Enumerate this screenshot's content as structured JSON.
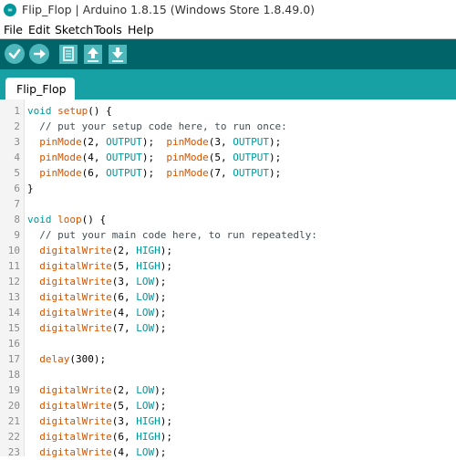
{
  "window": {
    "title": "Flip_Flop | Arduino 1.8.15 (Windows Store 1.8.49.0)",
    "logo_icon": "arduino-logo-icon"
  },
  "menu": [
    "File",
    "Edit",
    "Sketch",
    "Tools",
    "Help"
  ],
  "toolbar": {
    "buttons": [
      {
        "name": "verify",
        "icon": "checkmark-icon"
      },
      {
        "name": "upload",
        "icon": "right-arrow-icon"
      },
      {
        "name": "new",
        "icon": "document-icon"
      },
      {
        "name": "open",
        "icon": "up-arrow-icon"
      },
      {
        "name": "save",
        "icon": "down-arrow-icon"
      }
    ],
    "colors": {
      "bar": "#006468",
      "button": "#4db7bb",
      "tab_bar": "#17a1a5"
    }
  },
  "tabs": [
    {
      "label": "Flip_Flop",
      "active": true
    }
  ],
  "editor": {
    "syntax_colors": {
      "type": "#00979c",
      "function": "#d35400",
      "constant": "#00979c",
      "comment": "#434f54"
    },
    "lines": [
      {
        "n": "1",
        "tokens": [
          [
            "t",
            "void"
          ],
          [
            "p",
            " "
          ],
          [
            "f",
            "setup"
          ],
          [
            "p",
            "() {"
          ]
        ]
      },
      {
        "n": "2",
        "tokens": [
          [
            "c",
            "  // put your setup code here, to run once:"
          ]
        ]
      },
      {
        "n": "3",
        "tokens": [
          [
            "p",
            "  "
          ],
          [
            "f",
            "pinMode"
          ],
          [
            "p",
            "(2, "
          ],
          [
            "k",
            "OUTPUT"
          ],
          [
            "p",
            ");  "
          ],
          [
            "f",
            "pinMode"
          ],
          [
            "p",
            "(3, "
          ],
          [
            "k",
            "OUTPUT"
          ],
          [
            "p",
            ");"
          ]
        ]
      },
      {
        "n": "4",
        "tokens": [
          [
            "p",
            "  "
          ],
          [
            "f",
            "pinMode"
          ],
          [
            "p",
            "(4, "
          ],
          [
            "k",
            "OUTPUT"
          ],
          [
            "p",
            ");  "
          ],
          [
            "f",
            "pinMode"
          ],
          [
            "p",
            "(5, "
          ],
          [
            "k",
            "OUTPUT"
          ],
          [
            "p",
            ");"
          ]
        ]
      },
      {
        "n": "5",
        "tokens": [
          [
            "p",
            "  "
          ],
          [
            "f",
            "pinMode"
          ],
          [
            "p",
            "(6, "
          ],
          [
            "k",
            "OUTPUT"
          ],
          [
            "p",
            ");  "
          ],
          [
            "f",
            "pinMode"
          ],
          [
            "p",
            "(7, "
          ],
          [
            "k",
            "OUTPUT"
          ],
          [
            "p",
            ");"
          ]
        ]
      },
      {
        "n": "6",
        "tokens": [
          [
            "p",
            "}"
          ]
        ]
      },
      {
        "n": "7",
        "tokens": []
      },
      {
        "n": "8",
        "tokens": [
          [
            "t",
            "void"
          ],
          [
            "p",
            " "
          ],
          [
            "f",
            "loop"
          ],
          [
            "p",
            "() {"
          ]
        ]
      },
      {
        "n": "9",
        "tokens": [
          [
            "c",
            "  // put your main code here, to run repeatedly:"
          ]
        ]
      },
      {
        "n": "10",
        "tokens": [
          [
            "p",
            "  "
          ],
          [
            "f",
            "digitalWrite"
          ],
          [
            "p",
            "(2, "
          ],
          [
            "k",
            "HIGH"
          ],
          [
            "p",
            ");"
          ]
        ]
      },
      {
        "n": "11",
        "tokens": [
          [
            "p",
            "  "
          ],
          [
            "f",
            "digitalWrite"
          ],
          [
            "p",
            "(5, "
          ],
          [
            "k",
            "HIGH"
          ],
          [
            "p",
            ");"
          ]
        ]
      },
      {
        "n": "12",
        "tokens": [
          [
            "p",
            "  "
          ],
          [
            "f",
            "digitalWrite"
          ],
          [
            "p",
            "(3, "
          ],
          [
            "k",
            "LOW"
          ],
          [
            "p",
            ");"
          ]
        ]
      },
      {
        "n": "13",
        "tokens": [
          [
            "p",
            "  "
          ],
          [
            "f",
            "digitalWrite"
          ],
          [
            "p",
            "(6, "
          ],
          [
            "k",
            "LOW"
          ],
          [
            "p",
            ");"
          ]
        ]
      },
      {
        "n": "14",
        "tokens": [
          [
            "p",
            "  "
          ],
          [
            "f",
            "digitalWrite"
          ],
          [
            "p",
            "(4, "
          ],
          [
            "k",
            "LOW"
          ],
          [
            "p",
            ");"
          ]
        ]
      },
      {
        "n": "15",
        "tokens": [
          [
            "p",
            "  "
          ],
          [
            "f",
            "digitalWrite"
          ],
          [
            "p",
            "(7, "
          ],
          [
            "k",
            "LOW"
          ],
          [
            "p",
            ");"
          ]
        ]
      },
      {
        "n": "16",
        "tokens": []
      },
      {
        "n": "17",
        "tokens": [
          [
            "p",
            "  "
          ],
          [
            "f",
            "delay"
          ],
          [
            "p",
            "(300);"
          ]
        ]
      },
      {
        "n": "18",
        "tokens": []
      },
      {
        "n": "19",
        "tokens": [
          [
            "p",
            "  "
          ],
          [
            "f",
            "digitalWrite"
          ],
          [
            "p",
            "(2, "
          ],
          [
            "k",
            "LOW"
          ],
          [
            "p",
            ");"
          ]
        ]
      },
      {
        "n": "20",
        "tokens": [
          [
            "p",
            "  "
          ],
          [
            "f",
            "digitalWrite"
          ],
          [
            "p",
            "(5, "
          ],
          [
            "k",
            "LOW"
          ],
          [
            "p",
            ");"
          ]
        ]
      },
      {
        "n": "21",
        "tokens": [
          [
            "p",
            "  "
          ],
          [
            "f",
            "digitalWrite"
          ],
          [
            "p",
            "(3, "
          ],
          [
            "k",
            "HIGH"
          ],
          [
            "p",
            ");"
          ]
        ]
      },
      {
        "n": "22",
        "tokens": [
          [
            "p",
            "  "
          ],
          [
            "f",
            "digitalWrite"
          ],
          [
            "p",
            "(6, "
          ],
          [
            "k",
            "HIGH"
          ],
          [
            "p",
            ");"
          ]
        ]
      },
      {
        "n": "23",
        "tokens": [
          [
            "p",
            "  "
          ],
          [
            "f",
            "digitalWrite"
          ],
          [
            "p",
            "(4, "
          ],
          [
            "k",
            "LOW"
          ],
          [
            "p",
            ");"
          ]
        ]
      }
    ]
  }
}
